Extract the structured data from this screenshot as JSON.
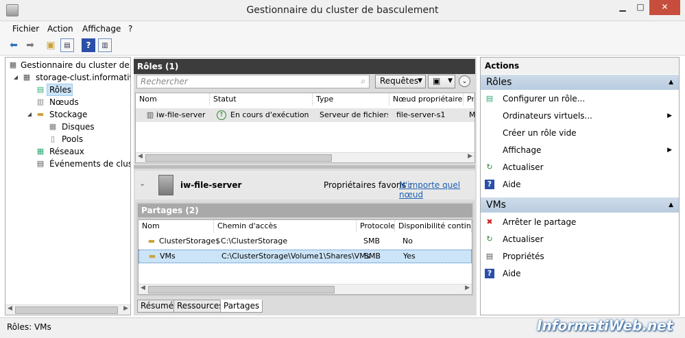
{
  "window": {
    "title": "Gestionnaire du cluster de basculement"
  },
  "menu": [
    "Fichier",
    "Action",
    "Affichage",
    "?"
  ],
  "tree": [
    {
      "label": "Gestionnaire du cluster de bas"
    },
    {
      "label": "storage-clust.informatiwe"
    },
    {
      "label": "Rôles"
    },
    {
      "label": "Nœuds"
    },
    {
      "label": "Stockage"
    },
    {
      "label": "Disques"
    },
    {
      "label": "Pools"
    },
    {
      "label": "Réseaux"
    },
    {
      "label": "Événements de cluster"
    }
  ],
  "roles": {
    "title": "Rôles (1)",
    "search_placeholder": "Rechercher",
    "queries_label": "Requêtes",
    "columns": [
      "Nom",
      "Statut",
      "Type",
      "Nœud propriétaire",
      "Pr"
    ],
    "rows": [
      {
        "name": "iw-file-server",
        "status": "En cours d'exécution",
        "type": "Serveur de fichiers...",
        "owner": "file-server-s1",
        "pr": "M"
      }
    ]
  },
  "detail": {
    "name": "iw-file-server",
    "owners_label": "Propriétaires favoris :",
    "owners_link": "N'importe quel nœud"
  },
  "shares": {
    "title": "Partages (2)",
    "columns": [
      "Nom",
      "Chemin d'accès",
      "Protocole",
      "Disponibilité continue"
    ],
    "rows": [
      {
        "name": "ClusterStorage$",
        "path": "C:\\ClusterStorage",
        "protocol": "SMB",
        "continuous": "No"
      },
      {
        "name": "VMs",
        "path": "C:\\ClusterStorage\\Volume1\\Shares\\VMs",
        "protocol": "SMB",
        "continuous": "Yes"
      }
    ]
  },
  "tabs": [
    "Résumé",
    "Ressources",
    "Partages"
  ],
  "actions": {
    "title": "Actions",
    "sections": [
      {
        "title": "Rôles",
        "items": [
          "Configurer un rôle...",
          "Ordinateurs virtuels...",
          "Créer un rôle vide",
          "Affichage",
          "Actualiser",
          "Aide"
        ]
      },
      {
        "title": "VMs",
        "items": [
          "Arrêter le partage",
          "Actualiser",
          "Propriétés",
          "Aide"
        ]
      }
    ]
  },
  "status": {
    "text": "Rôles:  VMs"
  },
  "watermark": "InformatiWeb.net",
  "colors": {
    "accent": "#2d5fa6",
    "selection": "#cce4f7",
    "pane_header": "#3c3c3c",
    "section": "#c4d4e6"
  }
}
